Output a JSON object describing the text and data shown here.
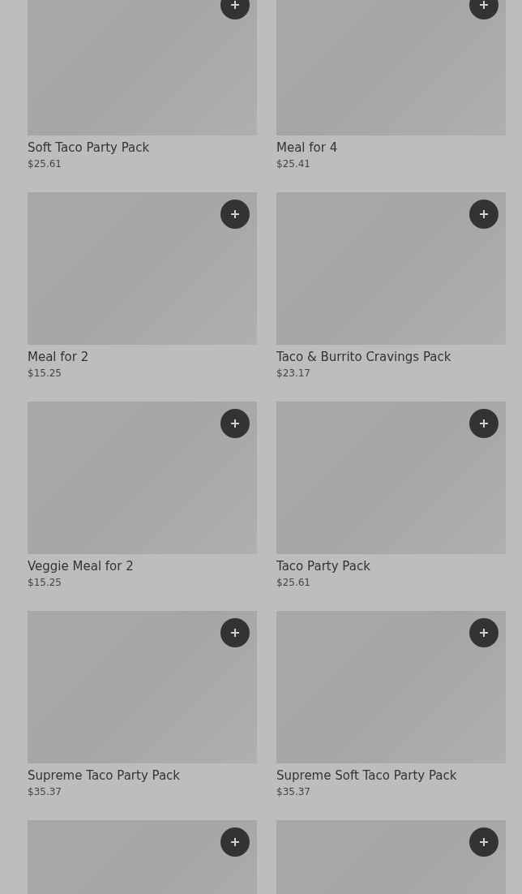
{
  "products": [
    {
      "kind": "picture",
      "title": "Soft Taco Party Pack",
      "price": "$25.61"
    },
    {
      "kind": "picture",
      "title": "Meal for 4",
      "price": "$25.41"
    },
    {
      "kind": "picture",
      "title": "Meal for 2",
      "price": "$15.25"
    },
    {
      "kind": "picture",
      "title": "Taco & Burrito Cravings Pack",
      "price": "$23.17"
    },
    {
      "kind": "picture",
      "title": "Veggie Meal for 2",
      "price": "$15.25"
    },
    {
      "kind": "picture",
      "title": "Taco Party Pack",
      "price": "$25.61"
    },
    {
      "kind": "picture",
      "title": "Supreme Taco Party Pack",
      "price": "$35.37"
    },
    {
      "kind": "picture",
      "title": "Supreme Soft Taco Party Pack",
      "price": "$35.37"
    },
    {
      "kind": "picture"
    },
    {
      "kind": "picture"
    }
  ]
}
